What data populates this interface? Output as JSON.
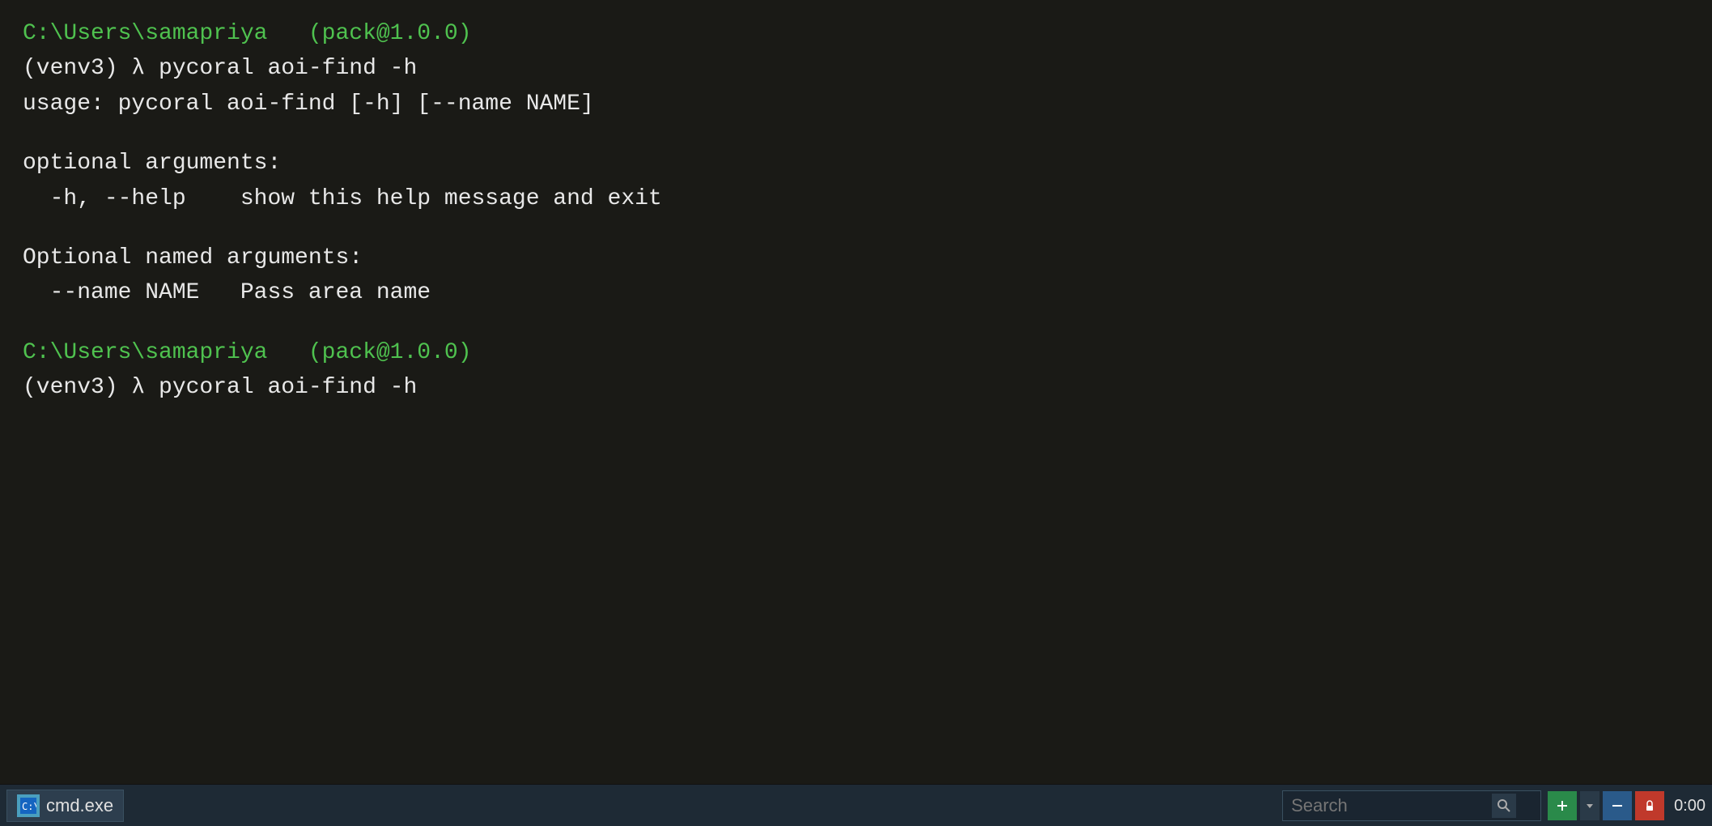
{
  "terminal": {
    "background_color": "#1a1a16",
    "lines": [
      {
        "type": "prompt",
        "content": "C:\\Users\\samapriya   (pack@1.0.0)"
      },
      {
        "type": "command",
        "content": "(venv3) λ pycoral aoi-find -h"
      },
      {
        "type": "output",
        "content": "usage: pycoral aoi-find [-h] [--name NAME]"
      },
      {
        "type": "blank"
      },
      {
        "type": "output",
        "content": "optional arguments:"
      },
      {
        "type": "output",
        "content": "  -h, --help    show this help message and exit"
      },
      {
        "type": "blank"
      },
      {
        "type": "output",
        "content": "Optional named arguments:"
      },
      {
        "type": "output",
        "content": "  --name NAME   Pass area name"
      },
      {
        "type": "blank"
      },
      {
        "type": "prompt",
        "content": "C:\\Users\\samapriya   (pack@1.0.0)"
      },
      {
        "type": "command",
        "content": "(venv3) λ pycoral aoi-find -h"
      }
    ]
  },
  "taskbar": {
    "app_label": "cmd.exe",
    "search_placeholder": "Search",
    "search_label": "Search",
    "time": "0:00"
  }
}
